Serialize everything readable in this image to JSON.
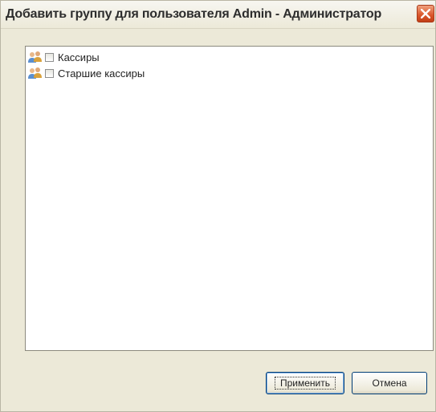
{
  "window": {
    "title": "Добавить группу для пользователя Admin - Администратор"
  },
  "groups": [
    {
      "label": "Кассиры",
      "checked": false,
      "icon": "users-group-icon"
    },
    {
      "label": "Старшие кассиры",
      "checked": false,
      "icon": "users-group-icon"
    }
  ],
  "buttons": {
    "apply_label": "Применить",
    "cancel_label": "Отмена"
  },
  "icons": {
    "close": "close-icon"
  },
  "colors": {
    "close_button": "#d9552a",
    "dialog_background": "#ece9d8"
  }
}
